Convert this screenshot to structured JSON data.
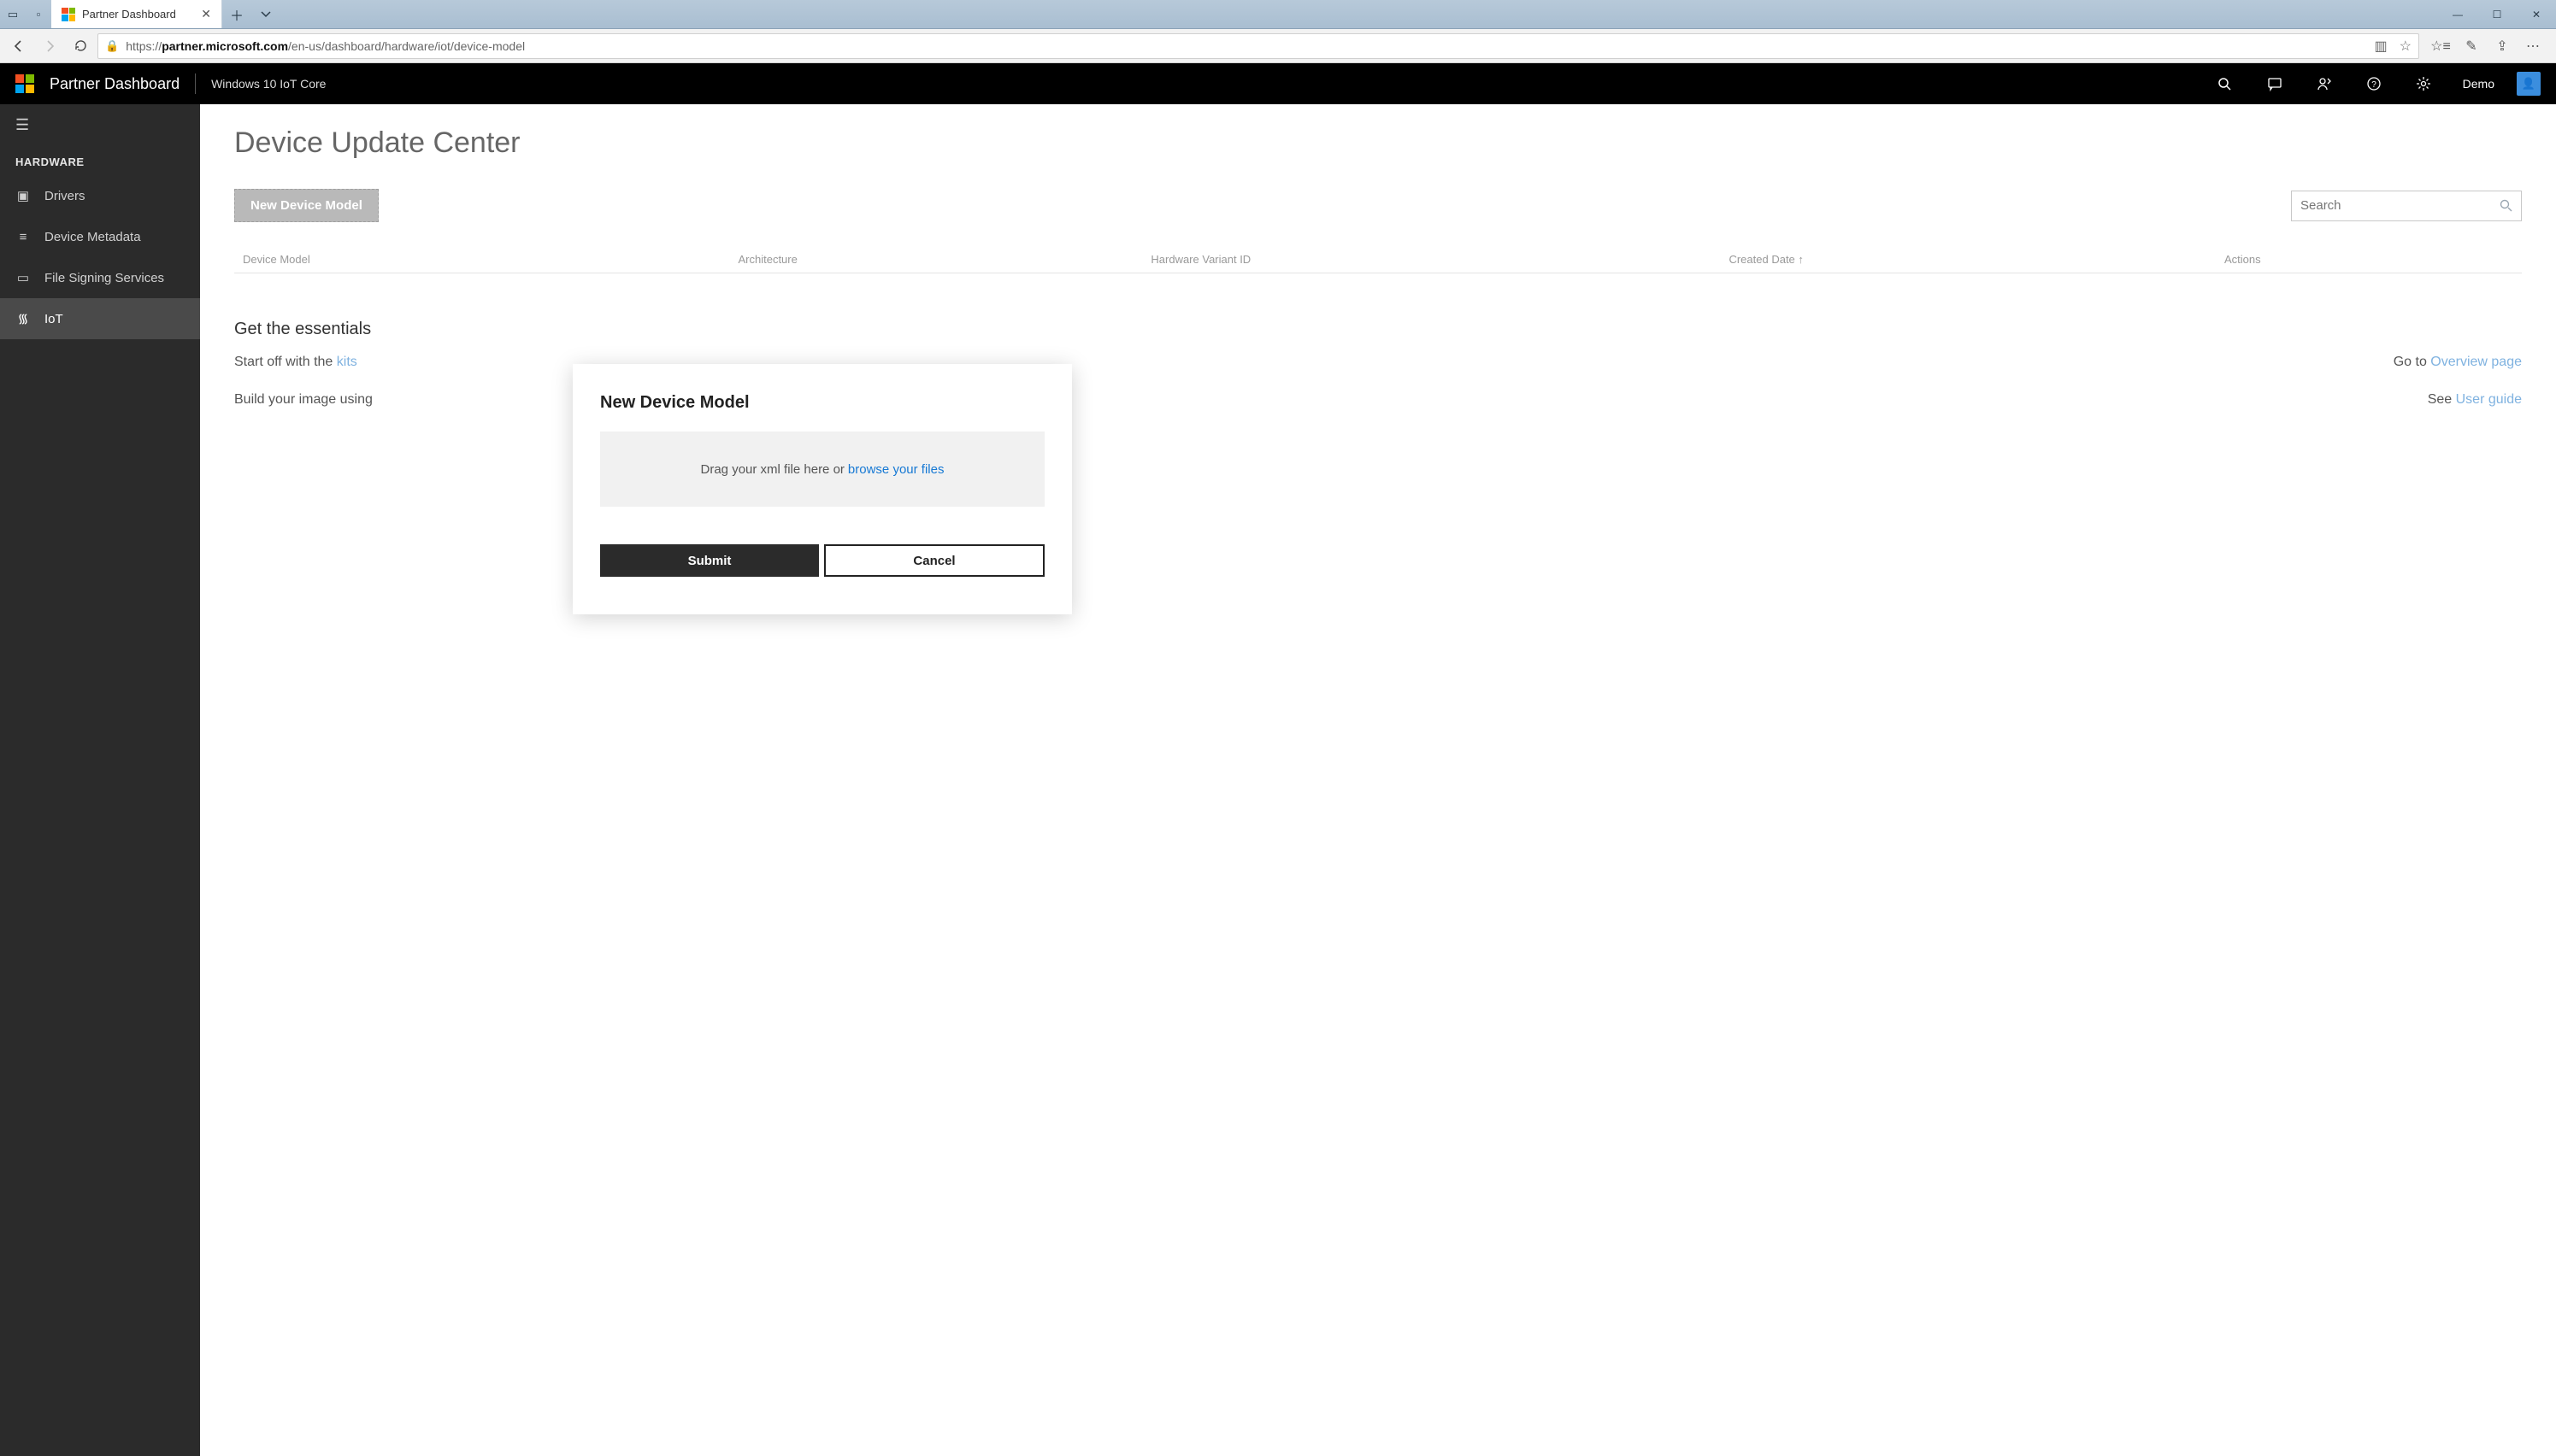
{
  "browser": {
    "tab_title": "Partner Dashboard",
    "url_host": "partner.microsoft.com",
    "url_path": "/en-us/dashboard/hardware/iot/device-model",
    "url_scheme": "https://"
  },
  "header": {
    "title": "Partner Dashboard",
    "subtitle": "Windows 10 IoT Core",
    "user": "Demo"
  },
  "sidebar": {
    "category": "HARDWARE",
    "items": [
      {
        "label": "Drivers"
      },
      {
        "label": "Device Metadata"
      },
      {
        "label": "File Signing Services"
      },
      {
        "label": "IoT"
      }
    ]
  },
  "page": {
    "title": "Device Update Center",
    "new_button": "New Device Model",
    "search_placeholder": "Search",
    "columns": {
      "c1": "Device Model",
      "c2": "Architecture",
      "c3": "Hardware Variant ID",
      "c4": "Created Date  ↑",
      "c5": "Actions"
    },
    "essentials": {
      "heading": "Get the essentials",
      "left1_prefix": "Start off with the ",
      "left1_link": "kits",
      "left2_prefix": "Build your image using ",
      "right1_prefix": "Go to ",
      "right1_link": "Overview page",
      "right2_prefix": "See ",
      "right2_link": "User guide"
    }
  },
  "modal": {
    "title": "New Device Model",
    "drop_text": "Drag your xml file here or",
    "drop_link": "browse your files",
    "submit": "Submit",
    "cancel": "Cancel"
  }
}
